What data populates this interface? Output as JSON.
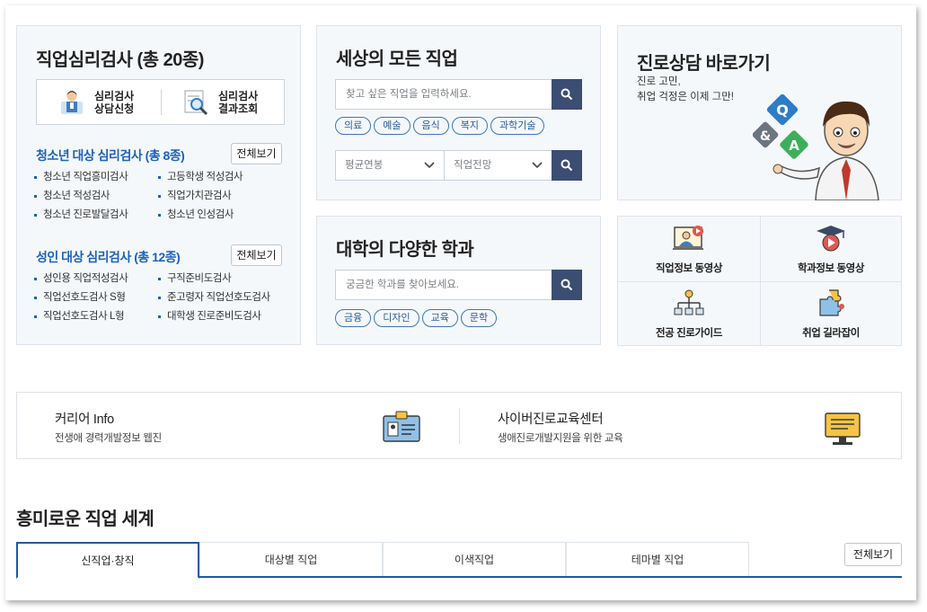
{
  "psych_test": {
    "title": "직업심리검사 (총 20종)",
    "quick": [
      {
        "label_l1": "심리검사",
        "label_l2": "상담신청",
        "icon": "counselor-icon"
      },
      {
        "label_l1": "심리검사",
        "label_l2": "결과조회",
        "icon": "magnifier-doc-icon"
      }
    ],
    "youth": {
      "title": "청소년 대상 심리검사 (총 8종)",
      "more_label": "전체보기",
      "items": [
        "청소년 직업흥미검사",
        "고등학생 적성검사",
        "청소년 적성검사",
        "직업가치관검사",
        "청소년 진로발달검사",
        "청소년 인성검사"
      ]
    },
    "adult": {
      "title": "성인 대상 심리검사 (총 12종)",
      "more_label": "전체보기",
      "items": [
        "성인용 직업적성검사",
        "구직준비도검사",
        "직업선호도검사 S형",
        "준고령자 직업선호도검사",
        "직업선호도검사 L형",
        "대학생 진로준비도검사"
      ]
    }
  },
  "jobs": {
    "title": "세상의 모든 직업",
    "search_placeholder": "찾고 싶은 직업을 입력하세요.",
    "tags": [
      "의료",
      "예술",
      "음식",
      "복지",
      "과학기술"
    ],
    "select_salary": "평균연봉",
    "select_outlook": "직업전망"
  },
  "majors": {
    "title": "대학의 다양한 학과",
    "search_placeholder": "궁금한 학과를 찾아보세요.",
    "tags": [
      "금융",
      "디자인",
      "교육",
      "문학"
    ]
  },
  "counsel": {
    "title": "진로상담 바로가기",
    "sub_l1": "진로 고민,",
    "sub_l2": "취업 걱정은 이제 그만!"
  },
  "grid": [
    {
      "label": "직업정보 동영상",
      "icon": "job-video-icon"
    },
    {
      "label": "학과정보 동영상",
      "icon": "major-video-icon"
    },
    {
      "label": "전공 진로가이드",
      "icon": "org-chart-icon"
    },
    {
      "label": "취업 길라잡이",
      "icon": "puzzle-icon"
    }
  ],
  "banner": {
    "left_title": "커리어 Info",
    "left_sub": "전생애 경력개발정보 웹진",
    "right_title": "사이버진로교육센터",
    "right_sub": "생애진로개발지원을 위한 교육"
  },
  "world": {
    "title": "흥미로운 직업 세계",
    "tabs": [
      "신직업·창직",
      "대상별 직업",
      "이색직업",
      "테마별 직업"
    ],
    "active_tab": 0,
    "more_label": "전체보기"
  },
  "colors": {
    "accent": "#1c63b7",
    "search_button": "#3b4d73",
    "panel_bg": "#f5f8fb"
  }
}
